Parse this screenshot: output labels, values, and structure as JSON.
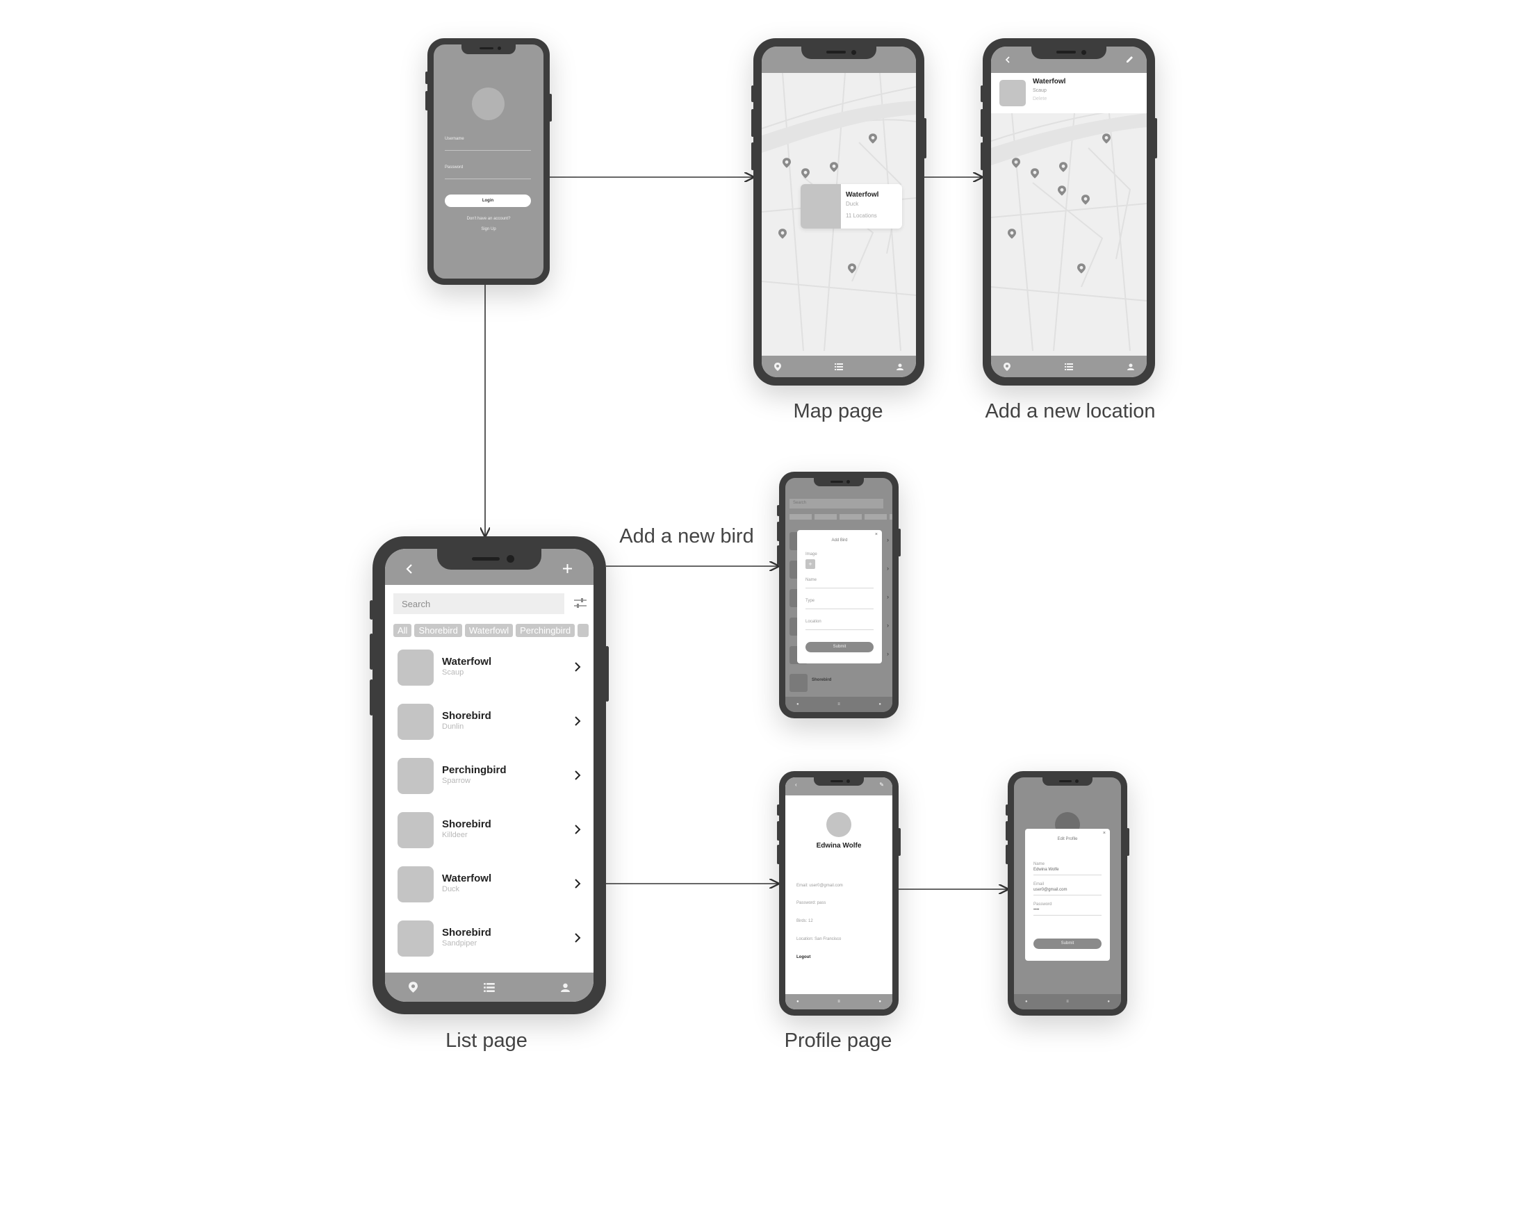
{
  "captions": {
    "map_page": "Map page",
    "add_location": "Add a new location",
    "add_bird": "Add a new bird",
    "list_page": "List page",
    "profile_page": "Profile page"
  },
  "login": {
    "username_label": "Username",
    "password_label": "Password",
    "login_button": "Login",
    "no_account": "Don't have an account?",
    "signup": "Sign Up"
  },
  "map": {
    "card_title": "Waterfowl",
    "card_sub": "Duck",
    "card_locations": "11 Locations"
  },
  "add_location": {
    "title": "Waterfowl",
    "sub": "Scaup",
    "delete": "Delete"
  },
  "list": {
    "search_placeholder": "Search",
    "chips": [
      "All",
      "Shorebird",
      "Waterfowl",
      "Perchingbird"
    ],
    "items": [
      {
        "title": "Waterfowl",
        "sub": "Scaup"
      },
      {
        "title": "Shorebird",
        "sub": "Dunlin"
      },
      {
        "title": "Perchingbird",
        "sub": "Sparrow"
      },
      {
        "title": "Shorebird",
        "sub": "Killdeer"
      },
      {
        "title": "Waterfowl",
        "sub": "Duck"
      },
      {
        "title": "Shorebird",
        "sub": "Sandpiper"
      }
    ]
  },
  "add_bird_modal": {
    "search": "Search",
    "title": "Add Bird",
    "image_label": "Image",
    "name_label": "Name",
    "type_label": "Type",
    "location_label": "Location",
    "submit": "Submit",
    "bottom_row_title": "Shorebird"
  },
  "profile": {
    "name": "Edwina Wolfe",
    "email": "Email: user0@gmail.com",
    "password": "Password: pass",
    "birds": "Birds: 12",
    "location": "Location: San Francisco",
    "logout": "Logout"
  },
  "edit_profile": {
    "title": "Edit Profile",
    "name_label": "Name",
    "name_value": "Edwina Wolfe",
    "email_label": "Email",
    "email_value": "user0@gmail.com",
    "password_label": "Password",
    "password_value": "••••",
    "submit": "Submit"
  }
}
